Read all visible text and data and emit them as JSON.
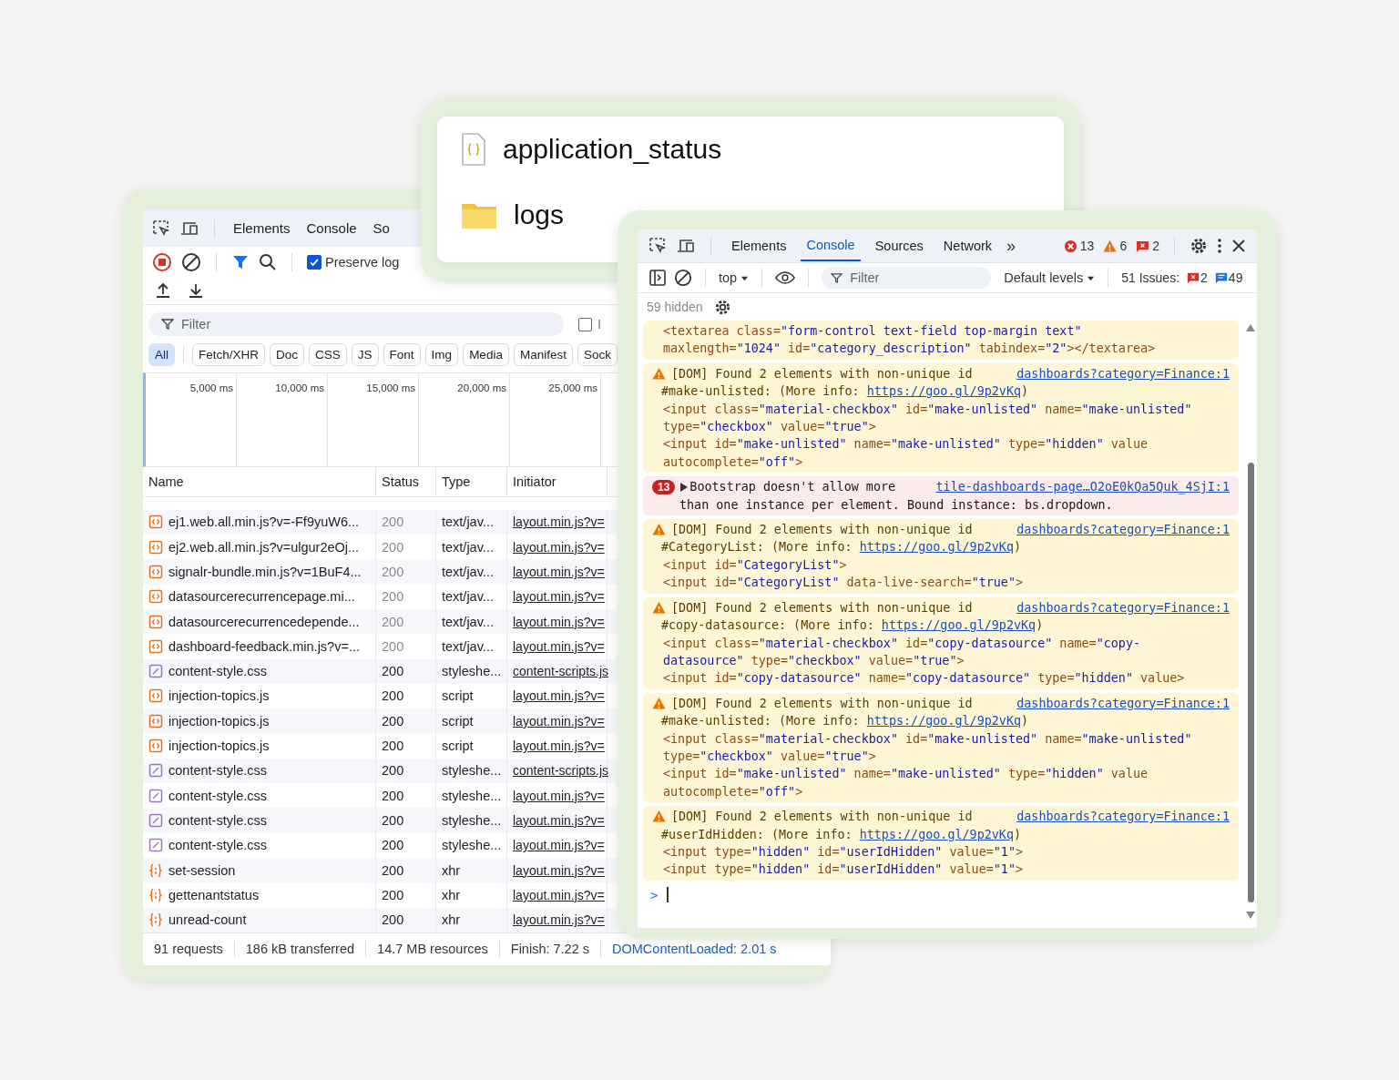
{
  "network_window": {
    "tabs": [
      {
        "label": "Elements",
        "selected": false
      },
      {
        "label": "Console",
        "selected": false
      },
      {
        "label": "So",
        "selected": false
      }
    ],
    "preserve_log": {
      "label": "Preserve log",
      "checked": true
    },
    "filter": {
      "placeholder": "Filter"
    },
    "invert": {
      "label": "I",
      "checked": false
    },
    "type_filters": [
      {
        "label": "All",
        "selected": true
      },
      {
        "label": "Fetch/XHR",
        "selected": false
      },
      {
        "label": "Doc",
        "selected": false
      },
      {
        "label": "CSS",
        "selected": false
      },
      {
        "label": "JS",
        "selected": false
      },
      {
        "label": "Font",
        "selected": false
      },
      {
        "label": "Img",
        "selected": false
      },
      {
        "label": "Media",
        "selected": false
      },
      {
        "label": "Manifest",
        "selected": false
      },
      {
        "label": "Sock",
        "selected": false
      }
    ],
    "timeline_ticks": [
      "5,000 ms",
      "10,000 ms",
      "15,000 ms",
      "20,000 ms",
      "25,000 ms"
    ],
    "columns": [
      "Name",
      "Status",
      "Type",
      "Initiator"
    ],
    "rows": [
      {
        "kind": "script",
        "name": "ej1.web.all.min.js?v=-Ff9yuW6...",
        "status": "200",
        "cached": true,
        "type": "text/jav...",
        "initiator": "layout.min.js?v="
      },
      {
        "kind": "script",
        "name": "ej2.web.all.min.js?v=ulgur2eOj...",
        "status": "200",
        "cached": true,
        "type": "text/jav...",
        "initiator": "layout.min.js?v="
      },
      {
        "kind": "script",
        "name": "signalr-bundle.min.js?v=1BuF4...",
        "status": "200",
        "cached": true,
        "type": "text/jav...",
        "initiator": "layout.min.js?v="
      },
      {
        "kind": "script",
        "name": "datasourcerecurrencepage.mi...",
        "status": "200",
        "cached": true,
        "type": "text/jav...",
        "initiator": "layout.min.js?v="
      },
      {
        "kind": "script",
        "name": "datasourcerecurrencedepende...",
        "status": "200",
        "cached": true,
        "type": "text/jav...",
        "initiator": "layout.min.js?v="
      },
      {
        "kind": "script",
        "name": "dashboard-feedback.min.js?v=...",
        "status": "200",
        "cached": true,
        "type": "text/jav...",
        "initiator": "layout.min.js?v="
      },
      {
        "kind": "stylesheet",
        "name": "content-style.css",
        "status": "200",
        "cached": false,
        "type": "styleshe...",
        "initiator": "content-scripts.js"
      },
      {
        "kind": "script",
        "name": "injection-topics.js",
        "status": "200",
        "cached": false,
        "type": "script",
        "initiator": "layout.min.js?v="
      },
      {
        "kind": "script",
        "name": "injection-topics.js",
        "status": "200",
        "cached": false,
        "type": "script",
        "initiator": "layout.min.js?v="
      },
      {
        "kind": "script",
        "name": "injection-topics.js",
        "status": "200",
        "cached": false,
        "type": "script",
        "initiator": "layout.min.js?v="
      },
      {
        "kind": "stylesheet",
        "name": "content-style.css",
        "status": "200",
        "cached": false,
        "type": "styleshe...",
        "initiator": "content-scripts.js"
      },
      {
        "kind": "stylesheet",
        "name": "content-style.css",
        "status": "200",
        "cached": false,
        "type": "styleshe...",
        "initiator": "layout.min.js?v="
      },
      {
        "kind": "stylesheet",
        "name": "content-style.css",
        "status": "200",
        "cached": false,
        "type": "styleshe...",
        "initiator": "layout.min.js?v="
      },
      {
        "kind": "stylesheet",
        "name": "content-style.css",
        "status": "200",
        "cached": false,
        "type": "styleshe...",
        "initiator": "layout.min.js?v="
      },
      {
        "kind": "xhr",
        "name": "set-session",
        "status": "200",
        "cached": false,
        "type": "xhr",
        "initiator": "layout.min.js?v="
      },
      {
        "kind": "xhr",
        "name": "gettenantstatus",
        "status": "200",
        "cached": false,
        "type": "xhr",
        "initiator": "layout.min.js?v="
      },
      {
        "kind": "xhr",
        "name": "unread-count",
        "status": "200",
        "cached": false,
        "type": "xhr",
        "initiator": "layout.min.js?v="
      }
    ],
    "status_bar": [
      "91 requests",
      "186 kB transferred",
      "14.7 MB resources",
      "Finish: 7.22 s"
    ],
    "dom_content_loaded": "DOMContentLoaded: 2.01 s"
  },
  "file_list": [
    {
      "kind": "json-file",
      "name": "application_status"
    },
    {
      "kind": "folder",
      "name": "logs"
    }
  ],
  "console_window": {
    "tabs": [
      {
        "label": "Elements",
        "selected": false
      },
      {
        "label": "Console",
        "selected": true
      },
      {
        "label": "Sources",
        "selected": false
      },
      {
        "label": "Network",
        "selected": false
      }
    ],
    "more_tabs": "»",
    "error_count": "13",
    "warning_count": "6",
    "issue_count": "2",
    "context": "top",
    "filter": {
      "placeholder": "Filter"
    },
    "levels": "Default levels",
    "issues_label": "51 Issues:",
    "issues_errors": "2",
    "issues_info": "49",
    "hidden": "59 hidden",
    "messages": [
      {
        "kind": "continuation",
        "code": [
          "<textarea class=\"form-control text-field top-margin text\" maxlength=\"1024\" id=\"category_description\" tabindex=\"2\"></textarea>"
        ]
      },
      {
        "kind": "warning",
        "text": "[DOM] Found 2 elements with non-unique id",
        "source": "dashboards?category=Finance:1",
        "ref": "#make-unlisted: (More info: ",
        "info_link": "https://goo.gl/9p2vKq",
        "info_end": ")",
        "code": [
          "<input class=\"material-checkbox\" id=\"make-unlisted\" name=\"make-unlisted\" type=\"checkbox\" value=\"true\">",
          "<input id=\"make-unlisted\" name=\"make-unlisted\" type=\"hidden\" value autocomplete=\"off\">"
        ]
      },
      {
        "kind": "error",
        "count": "13",
        "text": "Bootstrap doesn't allow more",
        "source": "tile-dashboards-page…O2oE0kQa5Quk_4SjI:1",
        "text_2": "than one instance per element. Bound instance: bs.dropdown."
      },
      {
        "kind": "warning",
        "text": "[DOM] Found 2 elements with non-unique id",
        "source": "dashboards?category=Finance:1",
        "ref": "#CategoryList: (More info: ",
        "info_link": "https://goo.gl/9p2vKq",
        "info_end": ")",
        "code": [
          "<input id=\"CategoryList\">",
          "<input id=\"CategoryList\" data-live-search=\"true\">"
        ]
      },
      {
        "kind": "warning",
        "text": "[DOM] Found 2 elements with non-unique id",
        "source": "dashboards?category=Finance:1",
        "ref": "#copy-datasource: (More info: ",
        "info_link": "https://goo.gl/9p2vKq",
        "info_end": ")",
        "code": [
          "<input class=\"material-checkbox\" id=\"copy-datasource\" name=\"copy-datasource\" type=\"checkbox\" value=\"true\">",
          "<input id=\"copy-datasource\" name=\"copy-datasource\" type=\"hidden\" value>"
        ]
      },
      {
        "kind": "warning",
        "text": "[DOM] Found 2 elements with non-unique id",
        "source": "dashboards?category=Finance:1",
        "ref": "#make-unlisted: (More info: ",
        "info_link": "https://goo.gl/9p2vKq",
        "info_end": ")",
        "code": [
          "<input class=\"material-checkbox\" id=\"make-unlisted\" name=\"make-unlisted\" type=\"checkbox\" value=\"true\">",
          "<input id=\"make-unlisted\" name=\"make-unlisted\" type=\"hidden\" value autocomplete=\"off\">"
        ]
      },
      {
        "kind": "warning",
        "text": "[DOM] Found 2 elements with non-unique id",
        "source": "dashboards?category=Finance:1",
        "ref": "#userIdHidden: (More info: ",
        "info_link": "https://goo.gl/9p2vKq",
        "info_end": ")",
        "code": [
          "<input type=\"hidden\" id=\"userIdHidden\" value=\"1\">",
          "<input type=\"hidden\" id=\"userIdHidden\" value=\"1\">"
        ]
      }
    ],
    "prompt": ">"
  }
}
